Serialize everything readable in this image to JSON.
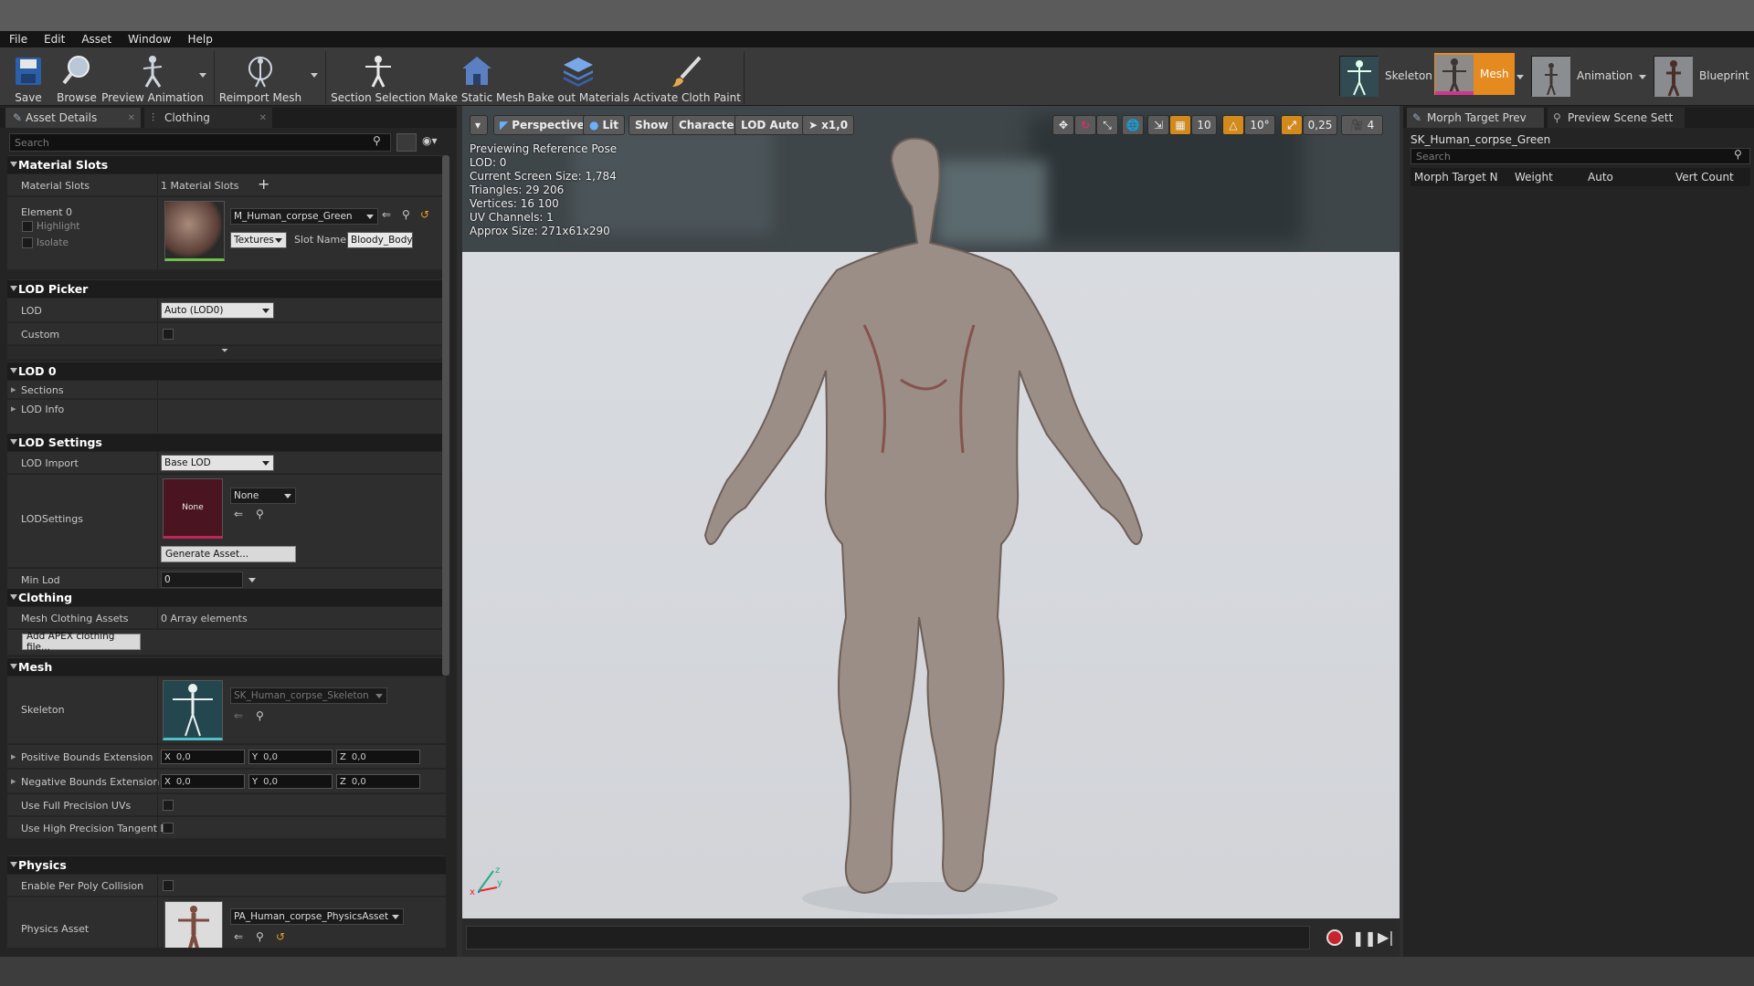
{
  "menu": [
    "File",
    "Edit",
    "Asset",
    "Window",
    "Help"
  ],
  "toolbar": {
    "save": "Save",
    "browse": "Browse",
    "preview_animation": "Preview Animation",
    "reimport_mesh": "Reimport Mesh",
    "section_selection": "Section Selection",
    "make_static_mesh": "Make Static Mesh",
    "bake_out_materials": "Bake out Materials",
    "activate_cloth_paint": "Activate Cloth Paint"
  },
  "modes": {
    "skeleton": "Skeleton",
    "mesh": "Mesh",
    "animation": "Animation",
    "blueprint": "Blueprint"
  },
  "left_tabs": {
    "asset_details": "Asset Details",
    "clothing": "Clothing"
  },
  "search_placeholder": "Search",
  "material_slots": {
    "header": "Material Slots",
    "label": "Material Slots",
    "count": "1 Material Slots",
    "element": "Element 0",
    "highlight": "Highlight",
    "isolate": "Isolate",
    "material": "M_Human_corpse_Green",
    "textures": "Textures",
    "slot_name_label": "Slot Name",
    "slot_name": "Bloody_Body"
  },
  "lod_picker": {
    "header": "LOD Picker",
    "lod_label": "LOD",
    "lod_value": "Auto (LOD0)",
    "custom_label": "Custom"
  },
  "lod0": {
    "header": "LOD 0",
    "sections": "Sections",
    "lod_info": "LOD Info"
  },
  "lod_settings": {
    "header": "LOD Settings",
    "lod_import_label": "LOD Import",
    "lod_import_value": "Base LOD",
    "lodsettings_label": "LODSettings",
    "thumb_none": "None",
    "combo_none": "None",
    "generate": "Generate Asset...",
    "min_lod_label": "Min Lod",
    "min_lod_value": "0"
  },
  "clothing": {
    "header": "Clothing",
    "mesh_clothing_label": "Mesh Clothing Assets",
    "array": "0 Array elements",
    "add_apex": "Add APEX clothing file..."
  },
  "mesh": {
    "header": "Mesh",
    "skeleton_label": "Skeleton",
    "skeleton_value": "SK_Human_corpse_Skeleton",
    "pos_bounds": "Positive Bounds Extension",
    "neg_bounds": "Negative Bounds Extension",
    "x": "X",
    "y": "Y",
    "z": "Z",
    "zero": "0,0",
    "full_precision": "Use Full Precision UVs",
    "high_precision": "Use High Precision Tangent B"
  },
  "physics": {
    "header": "Physics",
    "per_poly": "Enable Per Poly Collision",
    "asset_label": "Physics Asset",
    "asset_value": "PA_Human_corpse_PhysicsAsset"
  },
  "viewport": {
    "perspective": "Perspective",
    "lit": "Lit",
    "show": "Show",
    "character": "Character",
    "lod_auto": "LOD Auto",
    "speed": "x1,0",
    "grid": "10",
    "angle": "10°",
    "scale": "0,25",
    "cam": "4",
    "stats": [
      "Previewing Reference Pose",
      "LOD: 0",
      "Current Screen Size: 1,784",
      "Triangles: 29 206",
      "Vertices: 16 100",
      "UV Channels: 1",
      "Approx Size: 271x61x290"
    ]
  },
  "right_tabs": {
    "morph": "Morph Target Prev",
    "preview_scene": "Preview Scene Sett"
  },
  "right_panel": {
    "asset_name": "SK_Human_corpse_Green",
    "columns": [
      "Morph Target N",
      "Weight",
      "Auto",
      "Vert Count"
    ]
  }
}
